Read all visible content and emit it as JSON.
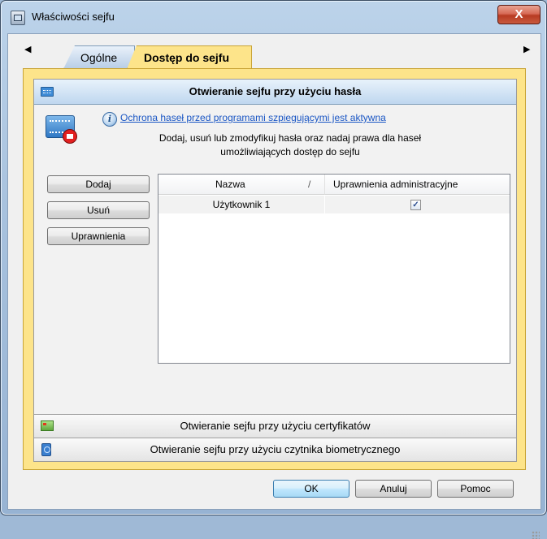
{
  "window": {
    "title": "Właściwości sejfu",
    "close_label": "X"
  },
  "tabs": {
    "scroll_left": "◀",
    "scroll_right": "▶",
    "items": [
      {
        "label": "Ogólne",
        "active": false
      },
      {
        "label": "Dostęp do sejfu",
        "active": true
      }
    ]
  },
  "password_section": {
    "title": "Otwieranie sejfu przy użyciu hasła",
    "info_link": "Ochrona haseł przed programami szpiegującymi jest aktywna",
    "description_line1": "Dodaj, usuń lub zmodyfikuj hasła oraz nadaj prawa dla haseł",
    "description_line2": "umożliwiających dostęp do sejfu",
    "buttons": {
      "add": "Dodaj",
      "remove": "Usuń",
      "permissions": "Uprawnienia"
    },
    "table": {
      "columns": [
        "Nazwa",
        "Uprawnienia administracyjne"
      ],
      "sort_indicator": "/",
      "rows": [
        {
          "name": "Użytkownik 1",
          "admin": true
        }
      ]
    }
  },
  "certificate_section": {
    "title": "Otwieranie sejfu przy użyciu certyfikatów"
  },
  "biometric_section": {
    "title": "Otwieranie sejfu przy użyciu czytnika biometrycznego"
  },
  "footer": {
    "ok": "OK",
    "cancel": "Anuluj",
    "help": "Pomoc"
  },
  "colors": {
    "active_tab": "#fde48a",
    "link": "#1a56c4",
    "close_button": "#c84a32"
  }
}
